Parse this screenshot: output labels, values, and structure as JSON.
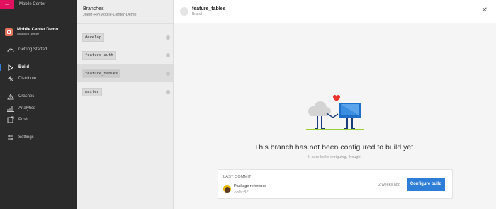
{
  "topbar": {
    "title": "Mobile Center",
    "back_icon": "arrow-left-icon"
  },
  "app": {
    "name": "Mobile Center Demo",
    "subtitle": "Mobile Center"
  },
  "nav": {
    "getting_started": "Getting Started",
    "build": "Build",
    "distribute": "Distribute",
    "crashes": "Crashes",
    "analytics": "Analytics",
    "push": "Push",
    "settings": "Settings",
    "active": "Build"
  },
  "branches": {
    "title": "Branches",
    "repo": "JoeM-RP/Mobile-Center-Demo",
    "items": [
      {
        "name": "develop",
        "selected": false
      },
      {
        "name": "feature_auth",
        "selected": false
      },
      {
        "name": "feature_tables",
        "selected": true
      },
      {
        "name": "master",
        "selected": false
      }
    ]
  },
  "main": {
    "title": "feature_tables",
    "subtitle": "Branch",
    "headline": "This branch has not been configured to build yet.",
    "subline": "It sure looks intriguing, though!"
  },
  "commit": {
    "label": "LAST COMMIT",
    "message": "Package reference",
    "author": "JoeM-RP",
    "time": "2 weeks ago",
    "button": "Configure build"
  },
  "colors": {
    "accent": "#2e7dd7",
    "brand_pink": "#e0115f",
    "sidebar_bg": "#2b2b2b",
    "heart": "#e8332f"
  }
}
